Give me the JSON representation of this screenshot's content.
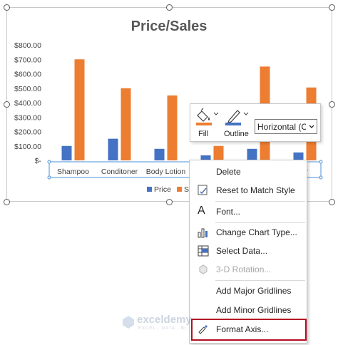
{
  "chart_data": {
    "type": "bar",
    "title": "Price/Sales",
    "categories": [
      "Shampoo",
      "Conditoner",
      "Body Lotion",
      "",
      "",
      "er"
    ],
    "series": [
      {
        "name": "Price",
        "color": "#4472c4",
        "values": [
          100,
          150,
          80,
          35,
          80,
          55
        ]
      },
      {
        "name": "Sal",
        "color": "#ed7d31",
        "values": [
          700,
          500,
          450,
          100,
          650,
          505
        ]
      }
    ],
    "yticks": [
      "$-",
      "$100.00",
      "$200.00",
      "$300.00",
      "$400.00",
      "$500.00",
      "$600.00",
      "$700.00",
      "$800.00"
    ],
    "ylim": [
      0,
      800
    ],
    "grid": false,
    "legend": "bottom"
  },
  "mini_toolbar": {
    "fill_label": "Fill",
    "outline_label": "Outline",
    "element_select_value": "Horizontal (Cat",
    "fill_color": "#ed7d31",
    "outline_color": "#4472c4"
  },
  "context_menu": {
    "items": [
      {
        "label": "Delete",
        "icon": "none",
        "enabled": true
      },
      {
        "label": "Reset to Match Style",
        "icon": "reset-style-icon",
        "enabled": true
      },
      {
        "label": "Font...",
        "icon": "font-icon",
        "enabled": true
      },
      {
        "label": "Change Chart Type...",
        "icon": "chart-type-icon",
        "enabled": true
      },
      {
        "label": "Select Data...",
        "icon": "select-data-icon",
        "enabled": true
      },
      {
        "label": "3-D Rotation...",
        "icon": "rotation-icon",
        "enabled": false
      },
      {
        "label": "Add Major Gridlines",
        "icon": "none",
        "enabled": true
      },
      {
        "label": "Add Minor Gridlines",
        "icon": "none",
        "enabled": true
      },
      {
        "label": "Format Axis...",
        "icon": "format-axis-icon",
        "enabled": true
      }
    ],
    "highlighted_item": "Format Axis..."
  },
  "watermark": {
    "name": "exceldemy",
    "tagline": "EXCEL · DATA · BI"
  }
}
